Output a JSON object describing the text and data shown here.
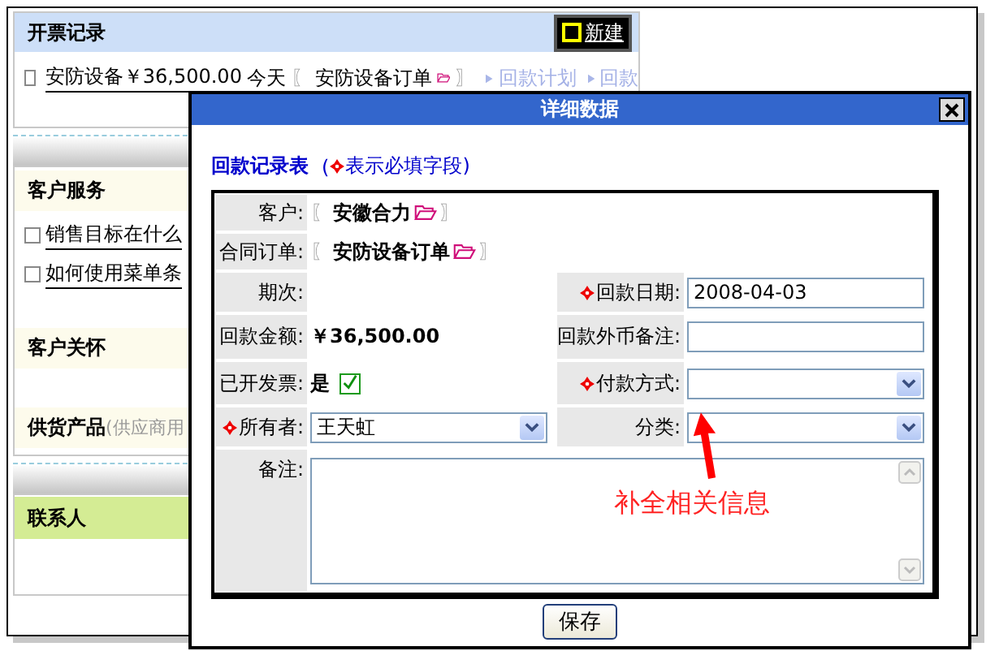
{
  "invoice_section": {
    "title": "开票记录",
    "new_button": "新建",
    "rows": [
      {
        "checked": false,
        "link": "安防设备￥36,500.00",
        "date": "今天",
        "bracket_open": "〖",
        "order": "安防设备订单",
        "bracket_close": "〗",
        "actions": [
          "回款计划",
          "回款"
        ]
      }
    ]
  },
  "service_section": {
    "title": "客户服务",
    "items": [
      {
        "checked": false,
        "text": "销售目标在什么"
      },
      {
        "checked": false,
        "text": "如何使用菜单条"
      }
    ]
  },
  "care_section": {
    "title": "客户关怀"
  },
  "supply_section": {
    "title": "供货产品",
    "note": "(供应商用"
  },
  "contacts_section": {
    "title": "联系人"
  },
  "dialog": {
    "title": "详细数据",
    "form_title": "回款记录表",
    "hint_open": "(",
    "hint_text": "表示必填字段)",
    "rows": [
      {
        "fields": [
          {
            "kind": "link",
            "label": "客户:",
            "required": false,
            "bracket_open": "〖",
            "value": "安徽合力",
            "bracket_close": "〗"
          }
        ]
      },
      {
        "fields": [
          {
            "kind": "link",
            "label": "合同订单:",
            "required": false,
            "bracket_open": "〖",
            "value": "安防设备订单",
            "bracket_close": "〗"
          }
        ]
      },
      {
        "fields": [
          {
            "kind": "text",
            "label": "期次:",
            "required": false
          },
          {
            "kind": "input",
            "label": "回款日期:",
            "required": true,
            "value": "2008-04-03"
          }
        ]
      },
      {
        "fields": [
          {
            "kind": "text",
            "label": "回款金额:",
            "required": false,
            "value": "￥36,500.00"
          },
          {
            "kind": "input",
            "label": "回款外币备注:",
            "required": false
          }
        ]
      },
      {
        "fields": [
          {
            "kind": "checkbox",
            "label": "已开发票:",
            "required": false,
            "value": "是",
            "checked": true
          },
          {
            "kind": "select",
            "label": "付款方式:",
            "required": true
          }
        ]
      },
      {
        "fields": [
          {
            "kind": "select",
            "label": "所有者:",
            "required": true,
            "value": "王天虹"
          },
          {
            "kind": "select",
            "label": "分类:",
            "required": false
          }
        ]
      },
      {
        "fields": [
          {
            "kind": "textarea",
            "label": "备注:",
            "required": false
          }
        ]
      }
    ],
    "save_button": "保存"
  },
  "annotation": {
    "text": "补全相关信息"
  }
}
